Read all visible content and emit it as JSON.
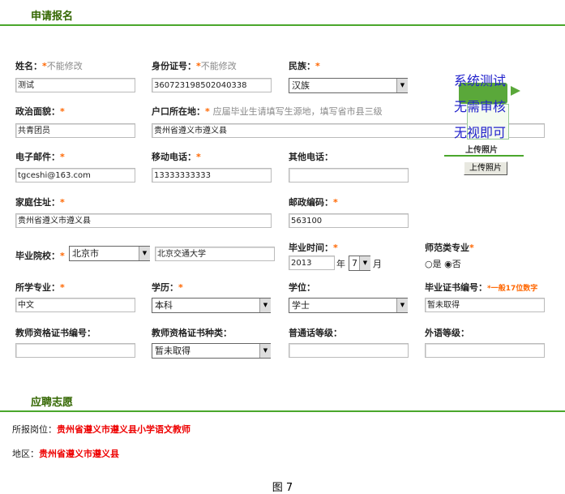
{
  "section1": {
    "title": "申请报名"
  },
  "fields": {
    "name": {
      "label": "姓名：",
      "hint": "不能修改",
      "value": "测试"
    },
    "id_no": {
      "label": "身份证号：",
      "hint": "不能修改",
      "value": "360723198502040338"
    },
    "ethnic": {
      "label": "民族：",
      "value": "汉族"
    },
    "political": {
      "label": "政治面貌：",
      "value": "共青团员"
    },
    "hukou": {
      "label": "户口所在地：",
      "hint": "应届毕业生请填写生源地，填写省市县三级",
      "value": "贵州省遵义市遵义县"
    },
    "email": {
      "label": "电子邮件：",
      "value": "tgceshi@163.com"
    },
    "mobile": {
      "label": "移动电话：",
      "value": "13333333333"
    },
    "other_phone": {
      "label": "其他电话：",
      "value": ""
    },
    "address": {
      "label": "家庭住址：",
      "value": "贵州省遵义市遵义县"
    },
    "postcode": {
      "label": "邮政编码：",
      "value": "563100"
    },
    "school": {
      "label": "毕业院校：",
      "city": "北京市",
      "value": "北京交通大学"
    },
    "grad_time": {
      "label": "毕业时间：",
      "year": "2013",
      "year_unit": "年",
      "month": "7",
      "month_unit": "月"
    },
    "normal_major": {
      "label": "师范类专业",
      "opt_yes": "是",
      "opt_no": "否",
      "selected": "否"
    },
    "major": {
      "label": "所学专业：",
      "value": "中文"
    },
    "education": {
      "label": "学历：",
      "value": "本科"
    },
    "degree": {
      "label": "学位：",
      "value": "学士"
    },
    "diploma_no": {
      "label": "毕业证书编号：",
      "hint": "一般17位数字",
      "value": "暂未取得"
    },
    "teacher_cert_no": {
      "label": "教师资格证书编号：",
      "value": ""
    },
    "teacher_cert_type": {
      "label": "教师资格证书种类：",
      "value": "暂未取得"
    },
    "mandarin": {
      "label": "普通话等级：",
      "value": ""
    },
    "foreign_lang": {
      "label": "外语等级：",
      "value": ""
    }
  },
  "req_mark": "*",
  "photo": {
    "overlay_lines": [
      "系统测试",
      "无需审核",
      "无视即可"
    ],
    "caption": "上传照片",
    "upload_button": "上传照片"
  },
  "section2": {
    "title": "应聘志愿",
    "position_label": "所报岗位：",
    "position_value": "贵州省遵义市遵义县小学语文教师",
    "region_label": "地区：",
    "region_value": "贵州省遵义市遵义县"
  },
  "figure_caption": "图 7"
}
